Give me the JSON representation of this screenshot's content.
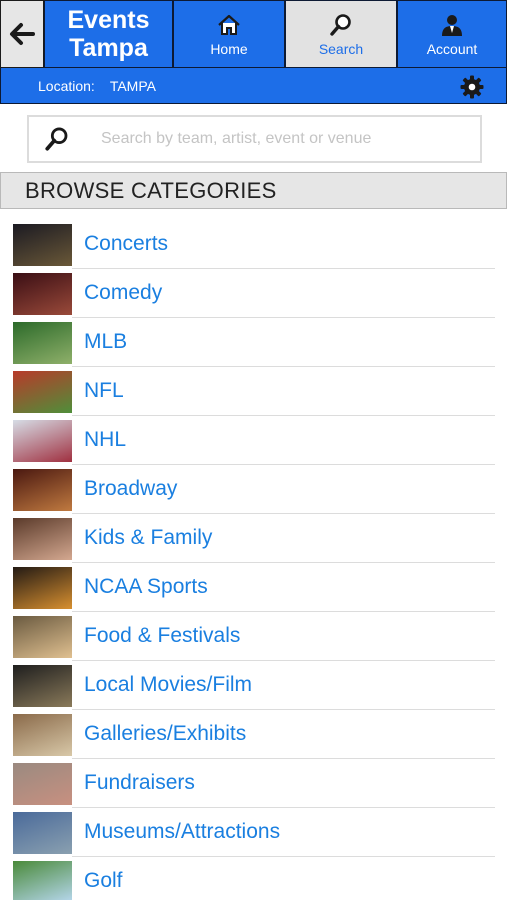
{
  "header": {
    "title_line1": "Events",
    "title_line2": "Tampa",
    "nav": [
      {
        "label": "Home",
        "icon": "home-icon"
      },
      {
        "label": "Search",
        "icon": "search-icon"
      },
      {
        "label": "Account",
        "icon": "account-icon"
      }
    ]
  },
  "location": {
    "label": "Location:",
    "value": "TAMPA"
  },
  "search": {
    "placeholder": "Search by team, artist, event or venue",
    "value": ""
  },
  "browse": {
    "title": "BROWSE CATEGORIES"
  },
  "categories": [
    {
      "label": "Concerts",
      "thumb": [
        "#1b1a22",
        "#6a5838"
      ]
    },
    {
      "label": "Comedy",
      "thumb": [
        "#3a0e14",
        "#9a4a3a"
      ]
    },
    {
      "label": "MLB",
      "thumb": [
        "#2c6a2a",
        "#8fb06a"
      ]
    },
    {
      "label": "NFL",
      "thumb": [
        "#b83a2a",
        "#4f8f3a"
      ]
    },
    {
      "label": "NHL",
      "thumb": [
        "#d6dde6",
        "#a03040"
      ]
    },
    {
      "label": "Broadway",
      "thumb": [
        "#4a1810",
        "#c07a40"
      ]
    },
    {
      "label": "Kids & Family",
      "thumb": [
        "#5a3a2a",
        "#d4a890"
      ]
    },
    {
      "label": "NCAA Sports",
      "thumb": [
        "#231a14",
        "#d89030"
      ]
    },
    {
      "label": "Food & Festivals",
      "thumb": [
        "#6a5a40",
        "#e0c090"
      ]
    },
    {
      "label": "Local Movies/Film",
      "thumb": [
        "#1e1e1e",
        "#8a7a5a"
      ]
    },
    {
      "label": "Galleries/Exhibits",
      "thumb": [
        "#8a6a4a",
        "#d8c8a8"
      ]
    },
    {
      "label": "Fundraisers",
      "thumb": [
        "#9a8a80",
        "#c89080"
      ]
    },
    {
      "label": "Museums/Attractions",
      "thumb": [
        "#4a6a9a",
        "#8aa0b0"
      ]
    },
    {
      "label": "Golf",
      "thumb": [
        "#4a8a3a",
        "#b8d8f0"
      ]
    }
  ],
  "colors": {
    "brand_blue": "#1d6ee8",
    "link_blue": "#1a7fe0"
  }
}
